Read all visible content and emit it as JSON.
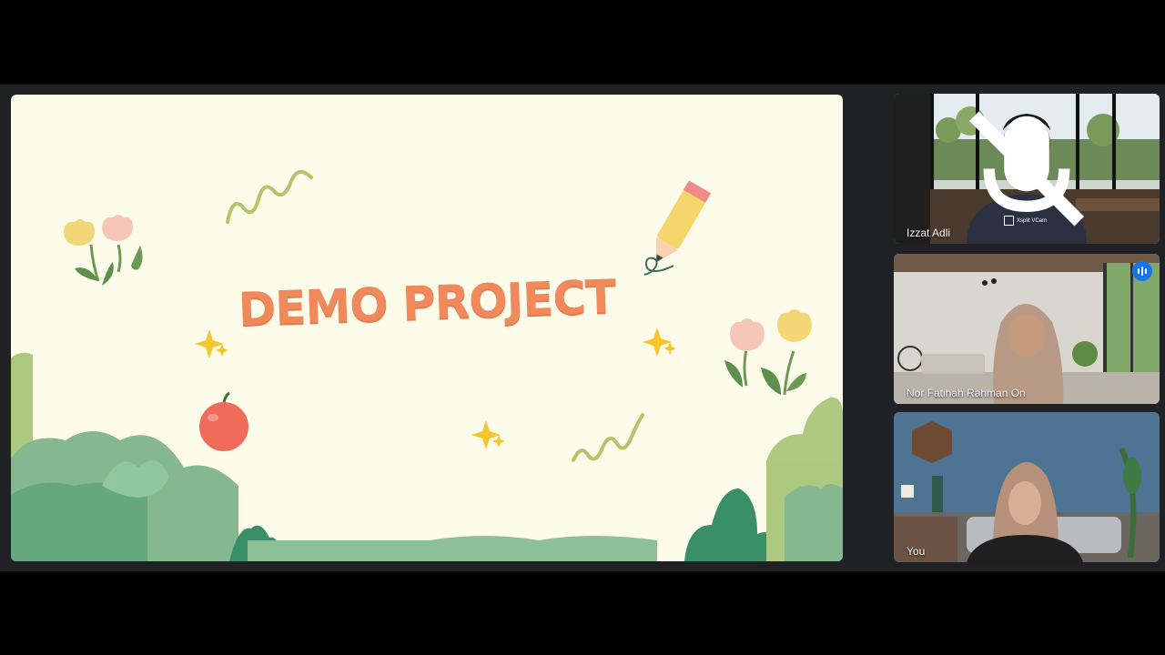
{
  "presentation": {
    "title": "DEMO PROJECT"
  },
  "participants": [
    {
      "name": "Izzat Adli",
      "mic": "mic-off-icon",
      "shirt_logo": "Xsplit VCam"
    },
    {
      "name": "Nor Fatihah Rahman On",
      "status": "speaking-indicator-icon"
    },
    {
      "name": "You"
    }
  ],
  "colors": {
    "slide_bg": "#fdfbe9",
    "title": "#f08a5d",
    "active_speaker_outline": "#8ab4f8",
    "speaking_badge": "#1a73e8"
  }
}
